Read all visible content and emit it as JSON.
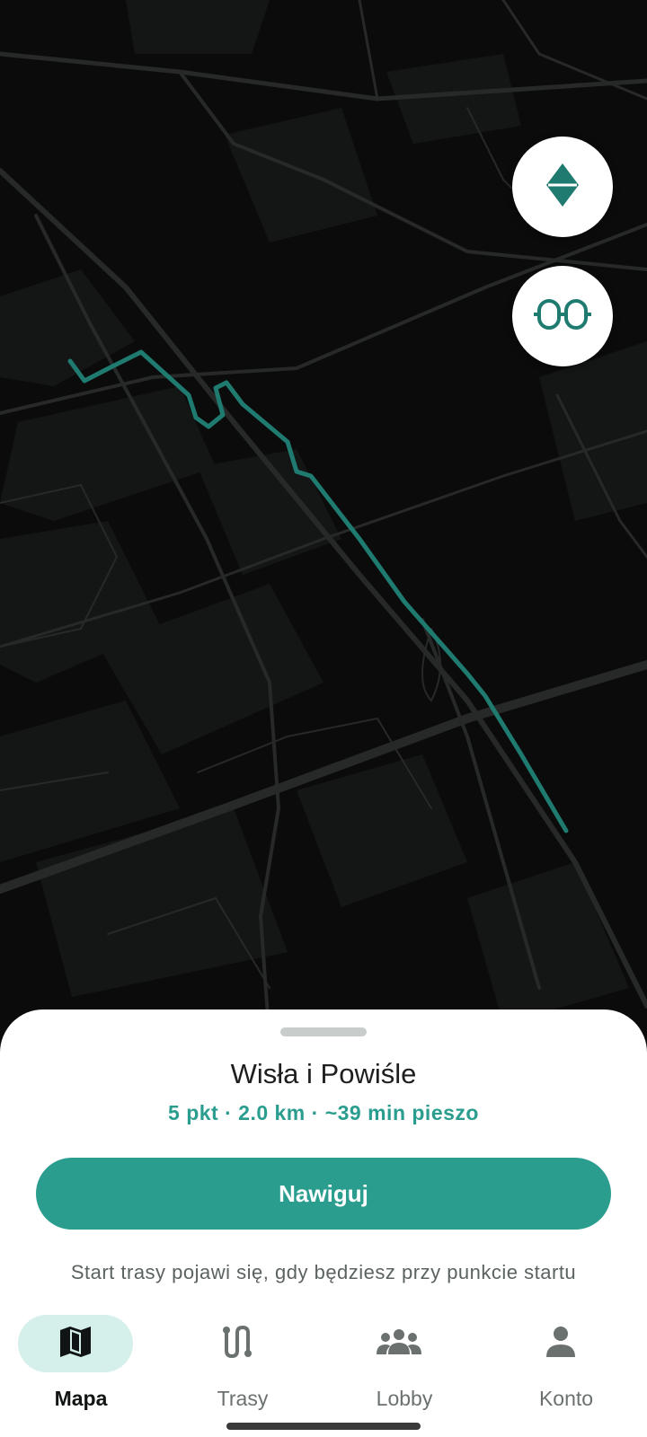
{
  "map": {
    "route_color": "#1f7a70",
    "background_color": "#0b0b0b"
  },
  "controls": {
    "compass_icon": "compass-icon",
    "glasses_icon": "glasses-icon"
  },
  "sheet": {
    "title": "Wisła i Powiśle",
    "subtitle": "5 pkt · 2.0 km · ~39 min pieszo",
    "button_label": "Nawiguj",
    "hint": "Start trasy pojawi się, gdy będziesz przy punkcie startu"
  },
  "bottom_nav": {
    "items": [
      {
        "label": "Mapa",
        "icon": "map-icon",
        "active": true
      },
      {
        "label": "Trasy",
        "icon": "route-icon",
        "active": false
      },
      {
        "label": "Lobby",
        "icon": "group-icon",
        "active": false
      },
      {
        "label": "Konto",
        "icon": "person-icon",
        "active": false
      }
    ]
  },
  "colors": {
    "accent": "#2a9d8f",
    "active_pill": "#d5efeb"
  }
}
